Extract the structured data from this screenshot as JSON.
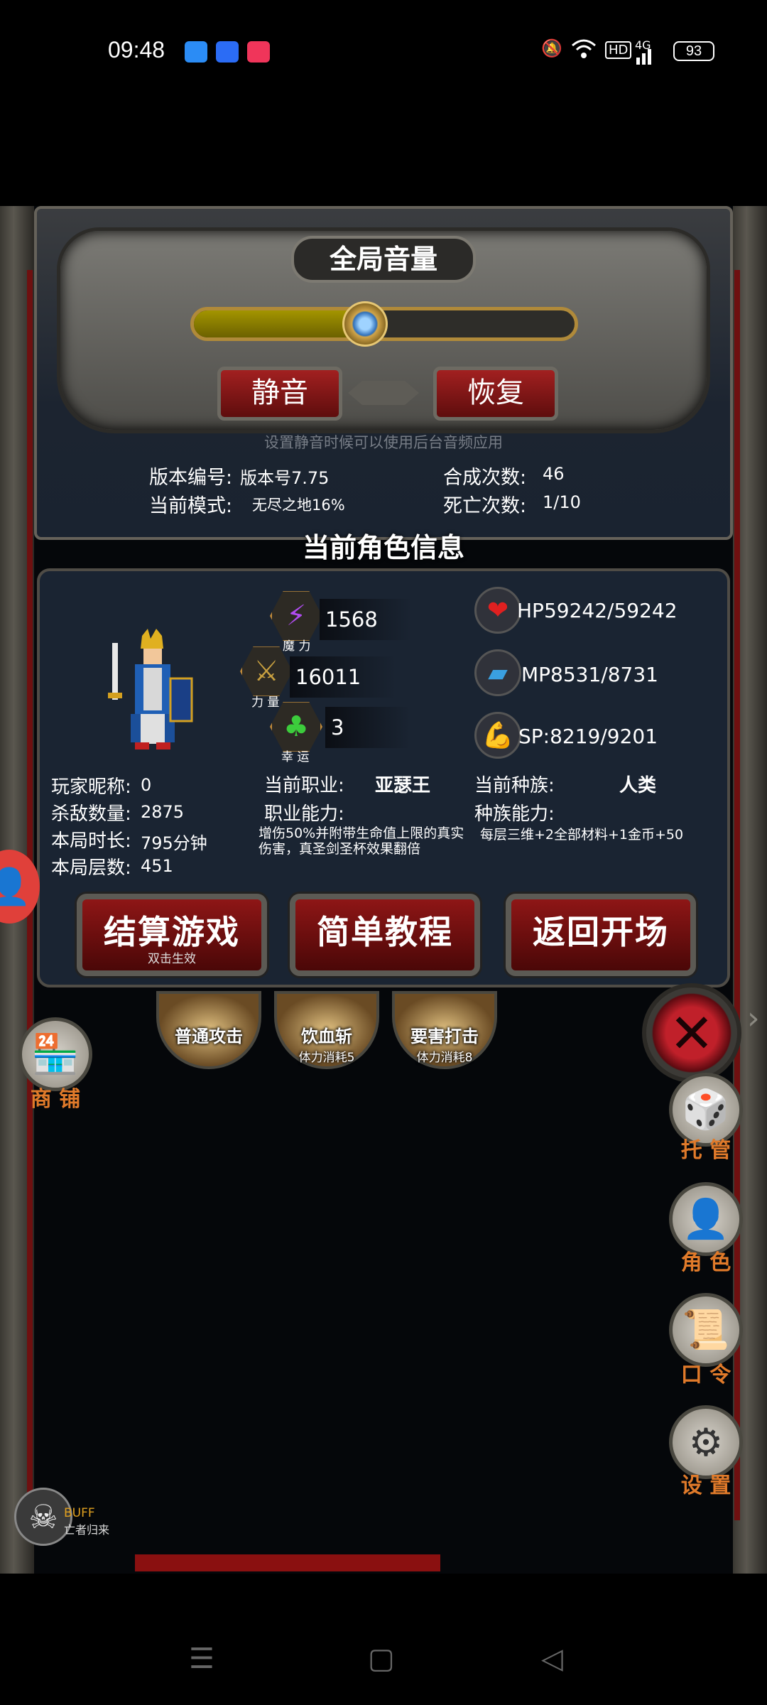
{
  "status_bar": {
    "time": "09:48",
    "battery": "93",
    "hd": "HD",
    "network": "4G"
  },
  "volume_panel": {
    "title": "全局音量",
    "volume_level_percent": 45,
    "mute_label": "静音",
    "restore_label": "恢复",
    "hint": "设置静音时候可以使用后台音频应用",
    "version_label": "版本编号:",
    "version_value": "版本号7.75",
    "mode_label": "当前模式:",
    "mode_value": "无尽之地16%",
    "craft_label": "合成次数:",
    "craft_value": "46",
    "death_label": "死亡次数:",
    "death_value": "1/10"
  },
  "character": {
    "section_title": "当前角色信息",
    "magic": {
      "value": "1568",
      "caption": "魔 力"
    },
    "strength": {
      "value": "16011",
      "caption": "力 量"
    },
    "luck": {
      "value": "3",
      "caption": "幸 运"
    },
    "hp": "HP59242/59242",
    "mp": "MP8531/8731",
    "sp": "SP:8219/9201",
    "nickname_label": "玩家昵称:",
    "nickname_value": "0",
    "kills_label": "杀敌数量:",
    "kills_value": "2875",
    "duration_label": "本局时长:",
    "duration_value": "795分钟",
    "floor_label": "本局层数:",
    "floor_value": "451",
    "job_label": "当前职业:",
    "job_value": "亚瑟王",
    "job_ability_label": "职业能力:",
    "job_ability_desc": "增伤50%并附带生命值上限的真实伤害，真圣剑圣杯效果翻倍",
    "race_label": "当前种族:",
    "race_value": "人类",
    "race_ability_label": "种族能力:",
    "race_ability_desc": "每层三维+2全部材料+1金币+50"
  },
  "actions": {
    "settle": "结算游戏",
    "settle_sub": "双击生效",
    "tutorial": "简单教程",
    "back": "返回开场"
  },
  "skills": [
    {
      "name": "普通攻击",
      "cost": ""
    },
    {
      "name": "饮血斩",
      "cost": "体力消耗5"
    },
    {
      "name": "要害打击",
      "cost": "体力消耗8"
    }
  ],
  "side_menu": {
    "shop": "商 铺",
    "auto": "托 管",
    "role": "角 色",
    "code": "口 令",
    "settings": "设 置"
  },
  "buff": {
    "label": "BUFF",
    "name": "亡者归来"
  }
}
